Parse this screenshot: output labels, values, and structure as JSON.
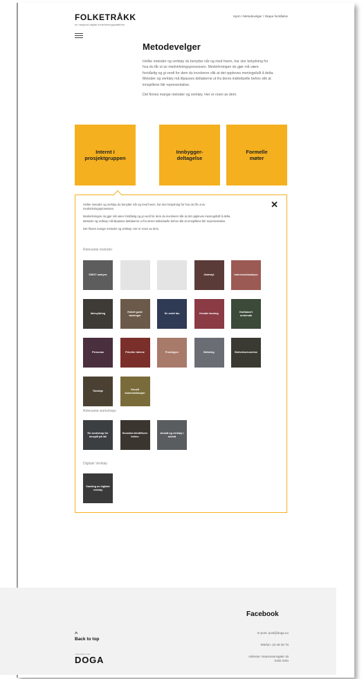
{
  "header": {
    "logo": "FOLKETRÅKK",
    "logo_tagline": "en nasjonal digital medvirkningsplattform",
    "breadcrumb": [
      "Hjem",
      "Metodevelger",
      "Skape forståelse"
    ],
    "breadcrumb_sep": " / "
  },
  "main": {
    "title": "Metodevelger",
    "intro": [
      "Hvilke metoder og verktøy du benytter når og med hvem, har stor betydning for hva du får ut av medvirkningsprosessen. Medvirkningen du gjør må være forståelig og gi verdi for dem du involverer slik at det oppleves meningsfullt å delta. Metoder og verktøy må tilpasses deltakerne ut fra deres individuelle behov slik at innspillene blir representative.",
      "Det finnes mange metoder og verktøy. Her er noen av dem."
    ],
    "cards": [
      "Internt i\nprosjektgruppen",
      "Innbygger-\ndeltagelse",
      "Formelle\nmøter"
    ]
  },
  "panel": {
    "close_label": "✕",
    "text": [
      "Hvilke metoder og verktøy du benytter når og med hvem, har stor betydning for hva du får ut av medvirkningsprosessen.",
      "Medvirkningen du gjør må være forståelig og gi verdi for dem du involverer slik at det oppleves meningsfullt å delta. Metoder og verktøy må tilpasses deltakerne ut fra deres individuelle behov slik at innspillene blir representative.",
      "Det finnes mange metoder og verktøy. Her er noen av dem."
    ],
    "methods_heading": "Relevante metoder",
    "methods": [
      {
        "label": "SWOT analyse",
        "bg": "#5d5d5d"
      },
      {
        "label": "",
        "bg": "#e4e4e4"
      },
      {
        "label": "",
        "bg": "#e4e4e4"
      },
      {
        "label": "Gatestyl",
        "bg": "#5a3b38"
      },
      {
        "label": "Interessentanalyse",
        "bg": "#9c5a55"
      },
      {
        "label": "Idémyldring",
        "bg": "#3e3a36"
      },
      {
        "label": "Enkelt gode løsninger",
        "bg": "#6b5a4a"
      },
      {
        "label": "Se ordet løs",
        "bg": "#2f3a55"
      },
      {
        "label": "Kreativ løsning",
        "bg": "#8a3b44"
      },
      {
        "label": "Kartbasert undersøk",
        "bg": "#3c4a3a"
      },
      {
        "label": "Personas",
        "bg": "#4a2f3e"
      },
      {
        "label": "Prioriter ideene",
        "bg": "#7a2f2a"
      },
      {
        "label": "Prototyper",
        "bg": "#a87a6a"
      },
      {
        "label": "Befaring",
        "bg": "#6a6e74"
      },
      {
        "label": "Skrivebord-øvelse",
        "bg": "#3a3a32"
      },
      {
        "label": "Tidslinje",
        "bg": "#4a4132"
      },
      {
        "label": "Visuell kommunikasjon",
        "bg": "#7a6c3a"
      }
    ],
    "workshops_heading": "Relevante workshops",
    "workshops": [
      {
        "label": "En workshop for innspill på idé",
        "bg": "#3c3f42"
      },
      {
        "label": "Hvordan identifisere behov",
        "bg": "#3b3530"
      },
      {
        "label": "Ansatt og verktøy i arbeid",
        "bg": "#5a5d60"
      }
    ],
    "tools_heading": "Digitale Verktøy",
    "tools": [
      {
        "label": "Samling av digitale verktøy",
        "bg": "#3a3a3a"
      }
    ]
  },
  "footer": {
    "back_to_top_arrow": "^",
    "back_to_top": "Back to top",
    "facebook": "Facebook",
    "email": "E-post: post@doga.no",
    "phone": "Telefon: 23 29 28 70",
    "address_1": "Adresse: Hausmannsgate 16",
    "address_2": "0182 Oslo",
    "doga_sub": "i samarbeid med",
    "doga": "DOGA"
  }
}
